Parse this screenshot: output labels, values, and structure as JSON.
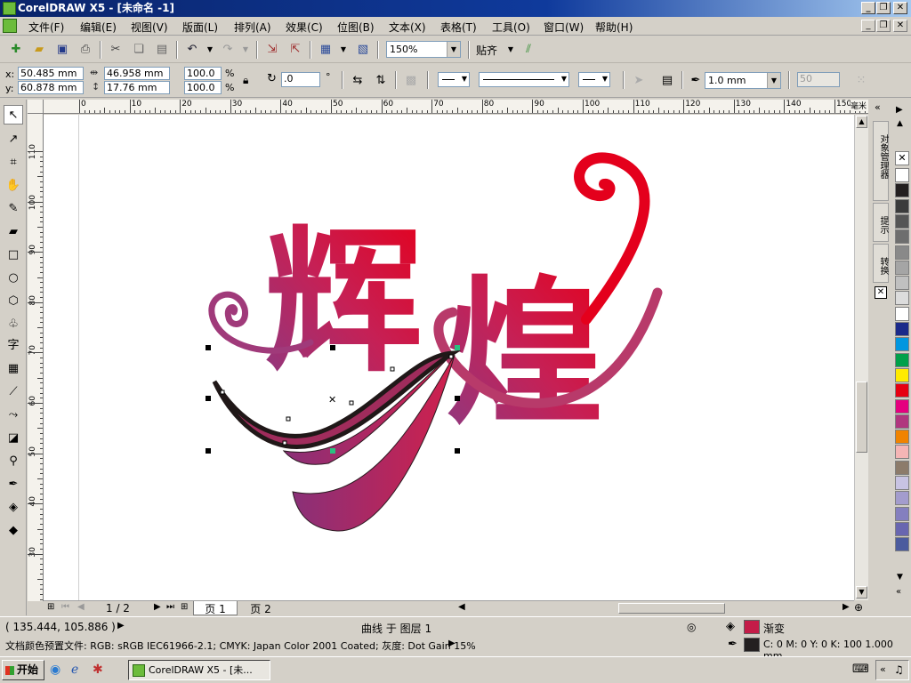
{
  "window": {
    "title": "CorelDRAW X5 - [未命名 -1]"
  },
  "menu": [
    "文件(F)",
    "编辑(E)",
    "视图(V)",
    "版面(L)",
    "排列(A)",
    "效果(C)",
    "位图(B)",
    "文本(X)",
    "表格(T)",
    "工具(O)",
    "窗口(W)",
    "帮助(H)"
  ],
  "toolbar": {
    "zoom": "150%",
    "snap_label": "贴齐"
  },
  "props": {
    "x": "50.485 mm",
    "y": "60.878 mm",
    "w": "46.958 mm",
    "h": "17.76 mm",
    "sx": "100.0",
    "sy": "100.0",
    "pct": "%",
    "angle": ".0",
    "deg": "°",
    "outline_width": "1.0 mm",
    "nib": "50",
    "x_label": "x:",
    "y_label": "y:"
  },
  "hruler_ticks": [
    "0",
    "10",
    "20",
    "30",
    "40",
    "50",
    "60",
    "70",
    "80",
    "90",
    "100",
    "110",
    "120",
    "130",
    "140",
    "150"
  ],
  "hruler_unit": "毫米",
  "vruler_ticks": [
    "110",
    "100",
    "90",
    "80",
    "70",
    "60",
    "50",
    "40",
    "30"
  ],
  "artwork": {
    "char1": "辉",
    "char2": "煌"
  },
  "pagebar": {
    "page_count": "1 / 2",
    "tab1": "页 1",
    "tab2": "页 2"
  },
  "status": {
    "coords": "( 135.444, 105.886 )",
    "object": "曲线 于 图层 1",
    "fill_label": "渐变",
    "profile": "文档颜色预置文件: RGB: sRGB IEC61966-2.1; CMYK: Japan Color 2001 Coated; 灰度: Dot Gain 15%",
    "outline": "C: 0 M: 0 Y: 0 K: 100  1.000 mm"
  },
  "dockers": [
    "对象管理器",
    "提示",
    "转换"
  ],
  "palette_colors": [
    "#ffffff",
    "#231f20",
    "#3b3b3b",
    "#555555",
    "#6e6e6e",
    "#898989",
    "#a5a5a5",
    "#c0c0c0",
    "#dcdcdc",
    "#ffffff",
    "#1b2a8a",
    "#0096e0",
    "#00a04a",
    "#ffeb00",
    "#e60012",
    "#e5007f",
    "#b0367e",
    "#f08300",
    "#f5b5b5",
    "#8c7b6b",
    "#c8c3e3",
    "#a39ccd",
    "#847fbf",
    "#6866b0",
    "#4b5b9e"
  ],
  "taskbar": {
    "start": "开始",
    "task": "CorelDRAW X5 - [未..."
  }
}
